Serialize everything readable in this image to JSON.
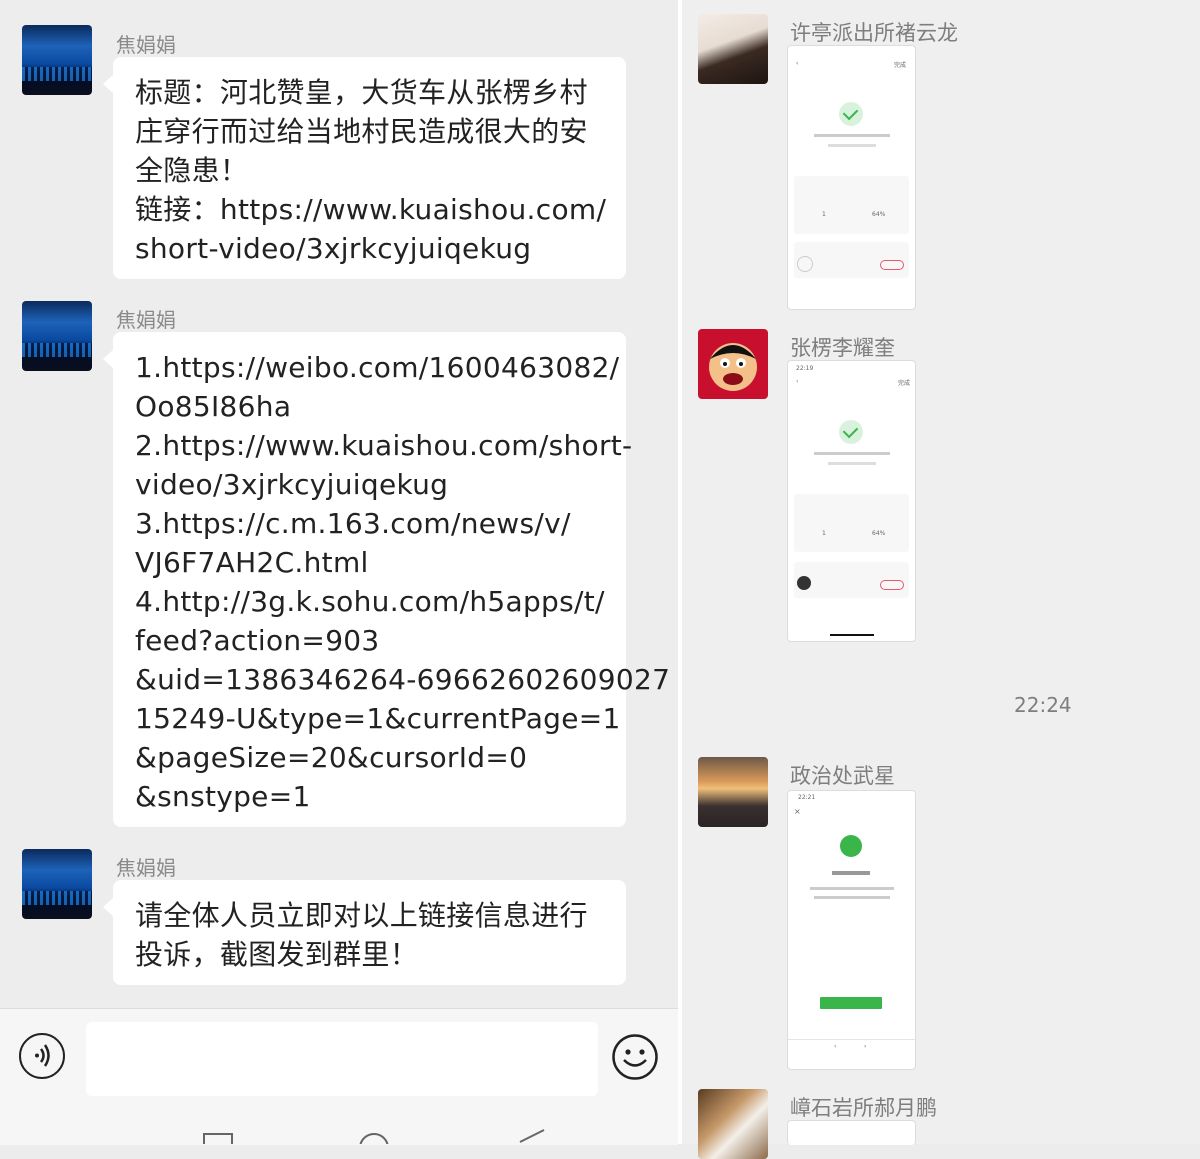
{
  "left_chat": {
    "messages": [
      {
        "sender": "焦娟娟",
        "lines": [
          "标题：河北赞皇，大货车从张楞乡村",
          "庄穿行而过给当地村民造成很大的安",
          "全隐患！",
          "链接：https://www.kuaishou.com/",
          "short-video/3xjrkcyjuiqekug"
        ]
      },
      {
        "sender": "焦娟娟",
        "lines": [
          "1.https://weibo.com/1600463082/",
          "Oo85I86ha",
          "2.https://www.kuaishou.com/short-",
          "video/3xjrkcyjuiqekug",
          "3.https://c.m.163.com/news/v/",
          "VJ6F7AH2C.html",
          "4.http://3g.k.sohu.com/h5apps/t/",
          "feed?action=903",
          "&uid=1386346264-69662602609027",
          "15249-U&type=1&currentPage=1",
          "&pageSize=20&cursorId=0",
          "&snstype=1"
        ]
      },
      {
        "sender": "焦娟娟",
        "lines": [
          "请全体人员立即对以上链接信息进行",
          "投诉，截图发到群里！"
        ]
      }
    ],
    "input": {
      "value": "",
      "placeholder": ""
    },
    "icons": {
      "voice": "voice-icon",
      "emoji": "emoji-icon"
    }
  },
  "right_chat": {
    "messages": [
      {
        "sender": "许亭派出所褚云龙",
        "screenshot": {
          "done_label": "完成",
          "count": "1",
          "percent": "64%"
        }
      },
      {
        "sender": "张楞李耀奎",
        "screenshot": {
          "time": "22:19",
          "done_label": "完成",
          "count": "1",
          "percent": "64%"
        }
      },
      {
        "sender": "政治处武星",
        "screenshot": {
          "time": "22:21"
        }
      },
      {
        "sender": "嶂石岩所郝月鹏",
        "screenshot": {}
      }
    ],
    "timestamp": "22:24"
  }
}
